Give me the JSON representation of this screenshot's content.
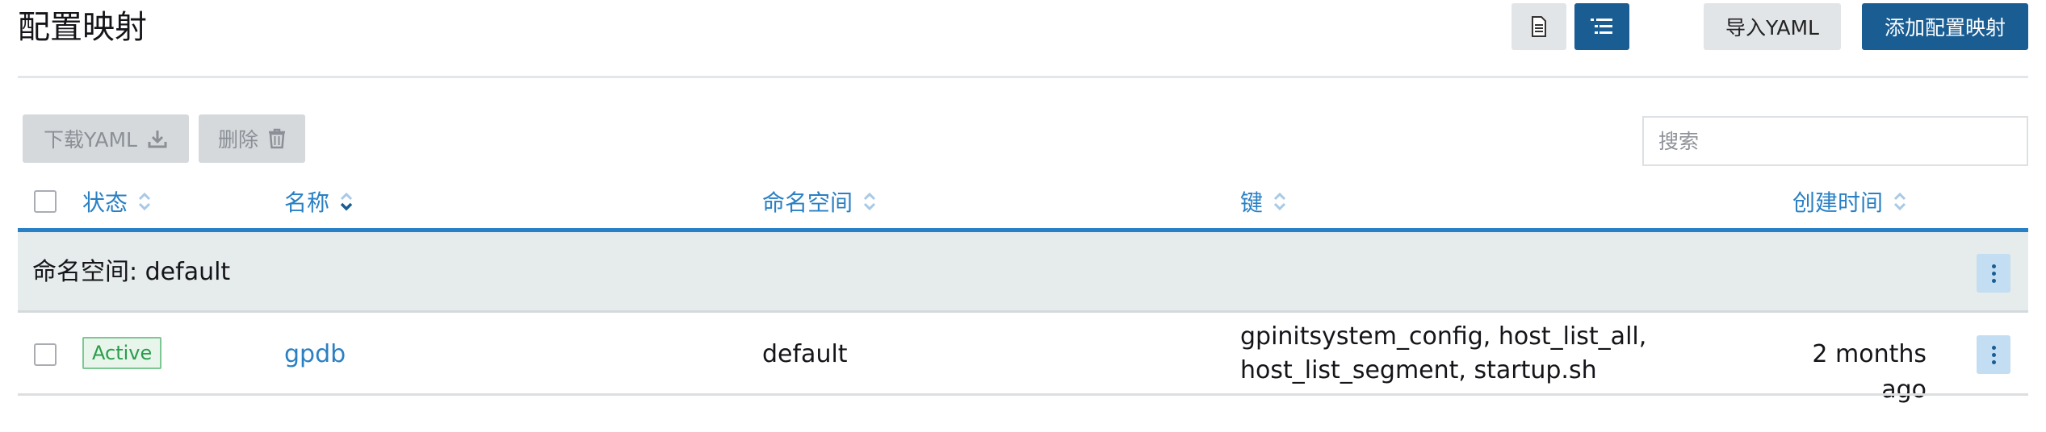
{
  "page": {
    "title": "配置映射"
  },
  "toolbar": {
    "import_label": "导入YAML",
    "add_label": "添加配置映射"
  },
  "bulk": {
    "download_label": "下载YAML",
    "delete_label": "删除"
  },
  "search": {
    "placeholder": "搜索"
  },
  "table": {
    "headers": {
      "state": "状态",
      "name": "名称",
      "namespace": "命名空间",
      "keys": "键",
      "created": "创建时间"
    },
    "group": {
      "label": "命名空间: default"
    },
    "rows": [
      {
        "state": "Active",
        "name": "gpdb",
        "namespace": "default",
        "keys_line1": "gpinitsystem_config, host_list_all,",
        "keys_line2": "host_list_segment, startup.sh",
        "created": "2 months ago"
      }
    ]
  },
  "icons": {
    "view_flat": "document-icon",
    "view_grouped": "list-tree-icon",
    "download": "download-icon",
    "delete": "trash-icon",
    "sort": "sort-icon",
    "menu": "kebab-icon"
  },
  "colors": {
    "primary": "#1a5d93",
    "link": "#2a80c4",
    "active_badge": "#2a9d4c",
    "group_bg": "#e6ebec"
  }
}
